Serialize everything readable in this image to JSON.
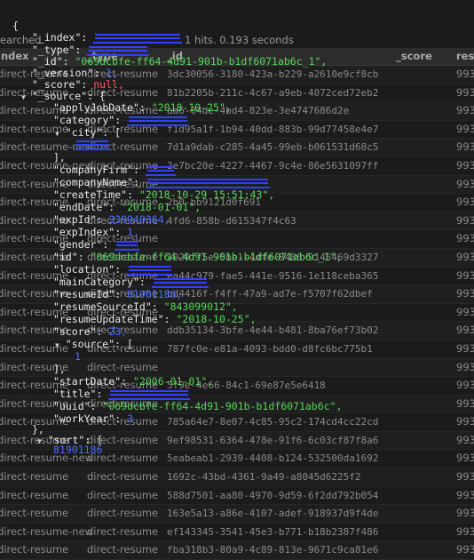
{
  "results": {
    "status_left": "earched",
    "status_right": "1 hits. 0.193 seconds",
    "columns": [
      "index",
      "_type",
      "_id",
      "_score",
      "res"
    ],
    "rows": [
      {
        "index": "direct-resume",
        "type": "direct-resume",
        "id": "3dc30056-3180-423a-b229-a2610e9cf8cb",
        "res": "993"
      },
      {
        "index": "direct-resume",
        "type": "direct-resume",
        "id": "81b2205b-211c-4c67-a9eb-4072ced72eb2",
        "res": "993"
      },
      {
        "index": "direct-resume",
        "type": "direct-resume",
        "id": "aa6-04de-4bd4-823e-3e4747686d2e",
        "res": "993"
      },
      {
        "index": "direct-resume",
        "type": "direct-resume",
        "id": "f1d95a1f-1b94-40dd-883b-99d77458e4e7",
        "res": "993"
      },
      {
        "index": "direct-resume-new",
        "type": "direct-resume",
        "id": "7d1a9dab-c285-4a45-99eb-b061531d68c5",
        "res": "993"
      },
      {
        "index": "direct-resume-new",
        "type": "direct-resume",
        "id": "2e7bc20e-4227-4467-9c4e-86e5631097ff",
        "res": "993"
      },
      {
        "index": "direct-resume",
        "type": "direct-resume",
        "id": "",
        "res": "993"
      },
      {
        "index": "direct-resume",
        "type": "direct-resume",
        "id": "2b0-bb9121d0f691",
        "res": "993"
      },
      {
        "index": "direct-resume",
        "type": "direct-resume",
        "id": "4fd6-858b-d615347f4c63",
        "res": "993"
      },
      {
        "index": "direct-resume",
        "type": "direct-resume",
        "id": "",
        "res": "993"
      },
      {
        "index": "direct-resume",
        "type": "direct-resume",
        "id": "1029ff5e-5be1-4dfe-8486-9145469d3327",
        "res": "993"
      },
      {
        "index": "direct-resume",
        "type": "direct-resume",
        "id": "ea44c979-fae5-441e-9516-1e118ceba365",
        "res": "993"
      },
      {
        "index": "direct-resume",
        "type": "direct-resume",
        "id": "bd4416f-f4ff-47a9-ad7e-f5707f62dbef",
        "res": "993"
      },
      {
        "index": "direct-resume",
        "type": "direct-resume",
        "id": "",
        "res": "993"
      },
      {
        "index": "direct-resume",
        "type": "direct-resume",
        "id": "ddb35134-3bfe-4e44-b481-8ba76ef73b02",
        "res": "993"
      },
      {
        "index": "direct-resume",
        "type": "direct-resume",
        "id": "787fc0e-e81a-4093-bdd0-d8fc6bc775b1",
        "res": "993"
      },
      {
        "index": "direct-resume",
        "type": "direct-resume",
        "id": "",
        "res": "993"
      },
      {
        "index": "direct-resume",
        "type": "direct-resume",
        "id": "5f9e-4e66-84c1-69e87e5e6418",
        "res": "993"
      },
      {
        "index": "direct-resume",
        "type": "direct-resume",
        "id": "",
        "res": "993"
      },
      {
        "index": "direct-resume",
        "type": "direct-resume",
        "id": "785a64e7-8e07-4c85-95c2-174cd4cc22cd",
        "res": "993"
      },
      {
        "index": "direct-resume",
        "type": "direct-resume",
        "id": "9ef98531-6364-478e-91f6-6c03cf87f8a6",
        "res": "993"
      },
      {
        "index": "direct-resume-new",
        "type": "direct-resume",
        "id": "5eabeab1-2939-4408-b124-532500da1692",
        "res": "993"
      },
      {
        "index": "direct-resume",
        "type": "direct-resume",
        "id": "1692c-43bd-4361-9a49-a8045d6225f2",
        "res": "993"
      },
      {
        "index": "direct-resume",
        "type": "direct-resume",
        "id": "588d7501-aa80-4970-9d59-6f2dd792b054",
        "res": "993"
      },
      {
        "index": "direct-resume",
        "type": "direct-resume",
        "id": "163e5a13-a86e-4107-adef-918937d9f4de",
        "res": "993"
      },
      {
        "index": "direct-resume-new",
        "type": "direct-resume",
        "id": "ef143345-3541-45e3-b771-b18b2387f486",
        "res": "993"
      },
      {
        "index": "direct-resume",
        "type": "direct-resume",
        "id": "fba318b3-80a9-4c89-813e-9671c9ca81e6",
        "res": "993"
      }
    ]
  },
  "json": {
    "open_brace": "{",
    "index_key": "\"_index\":",
    "type_key": "\"_type\":",
    "id_key": "\"_id\":",
    "id_val": "\"069dcbfe-ff64-4d91-901b-b1df6071ab6c_1\",",
    "version_key": "\"_version\":",
    "version_val": "1,",
    "score_key": "\"_score\":",
    "score_val": "null,",
    "source_key": "\"_source\": {",
    "applyJobDate_key": "\"applyJobDate\":",
    "applyJobDate_val": "\"2018-10-25\",",
    "category_key": "\"category\":",
    "city_key": "\"city\": [",
    "close_bracket_1": "],",
    "companyFirm_key": "\"companyFirm\":",
    "companyName_key": "\"companyName\":",
    "createTime_key": "\"createTime\":",
    "createTime_val": "\"2018-10-29 15:51:43\",",
    "endDate_key": "\"endDate\":",
    "endDate_val": "\"2018-01-01\",",
    "expId_key": "\"expId\":",
    "expId_val": "239940364,",
    "expIndex_key": "\"expIndex\":",
    "expIndex_val": "1,",
    "gender_key": "\"gender\":",
    "id2_key": "\"id\":",
    "id2_val": "\"069dcbfe-ff64-4d91-901b-b1df6071ab6c_1\",",
    "location_key": "\"location\":",
    "mainCategory_key": "\"mainCategory\":",
    "resumeId_key": "\"resumeId\":",
    "resumeId_val": "81901186,",
    "resumeSourceId_key": "\"resumeSourceId\":",
    "resumeSourceId_val": "\"843099012\",",
    "resumeUpdateTime_key": "\"resumeUpdateTime\":",
    "resumeUpdateTime_val": "\"2018-10-25\",",
    "score2_key": "\"score\":",
    "score2_val": "23,",
    "source2_key": "\"source\": [",
    "source2_item": "1",
    "close_bracket_2": "],",
    "startDate_key": "\"startDate\":",
    "startDate_val": "\"2006-01-01\",",
    "title_key": "\"title\":",
    "uuid_key": "\"uuid\":",
    "uuid_val": "\"069dcbfe-ff64-4d91-901b-b1df6071ab6c\",",
    "workYear_key": "\"workYear\":",
    "workYear_val": "3",
    "close_source": "},",
    "sort_key": "\"sort\": [",
    "sort_item": "81901186"
  }
}
